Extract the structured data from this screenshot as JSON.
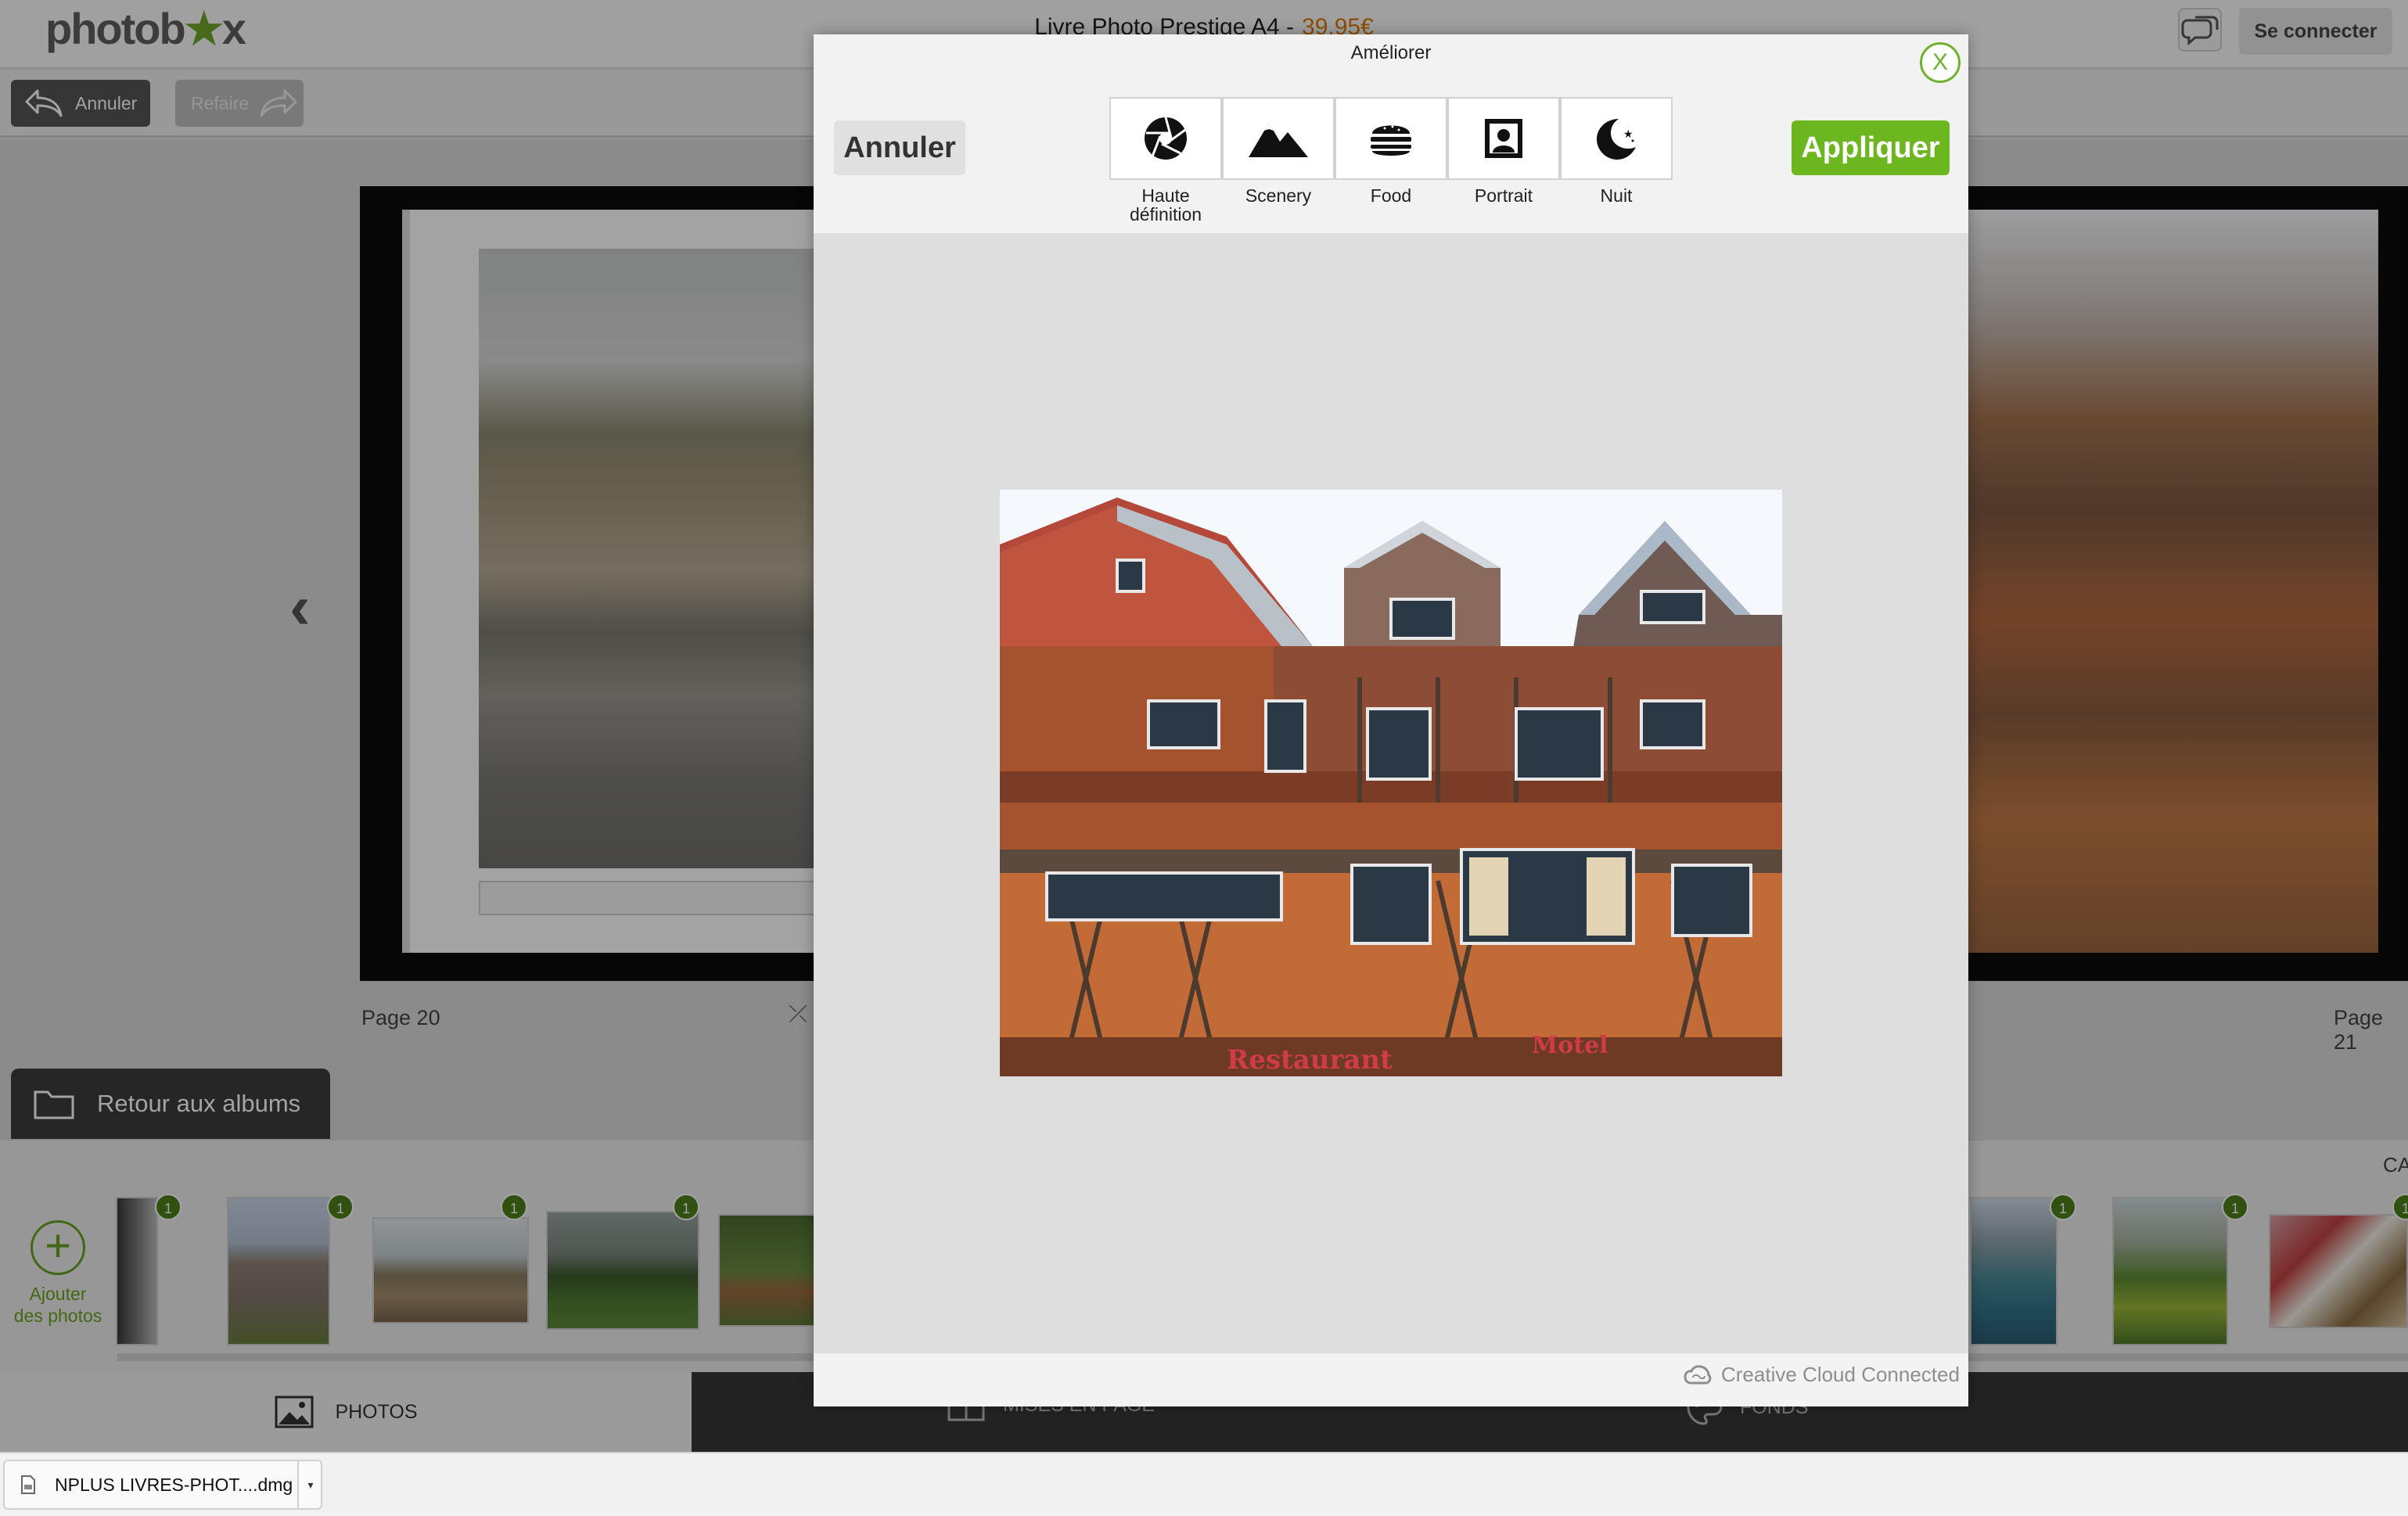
{
  "header": {
    "logo": {
      "pre": "photob",
      "post": "x"
    },
    "product_name": "Livre Photo Prestige A4 -",
    "product_price": "39.95€",
    "login_label": "Se connecter"
  },
  "toolbar": {
    "undo_label": "Annuler",
    "redo_label": "Refaire"
  },
  "book": {
    "left_page_label": "Page 20",
    "right_page_label": "Page 21"
  },
  "albums_button_label": "Retour aux albums",
  "photo_strip": {
    "add_label_line1": "Ajouter",
    "add_label_line2": "des photos",
    "badge_counts": [
      "1",
      "1",
      "1",
      "1",
      "1",
      "1",
      "1"
    ],
    "truncated_label": "CA"
  },
  "bottom_tabs": {
    "photos": "PHOTOS",
    "layouts": "MISES EN PAGE",
    "backgrounds": "FONDS"
  },
  "modal": {
    "title": "Améliorer",
    "close_label": "X",
    "cancel_label": "Annuler",
    "apply_label": "Appliquer",
    "presets": [
      {
        "label_line1": "Haute",
        "label_line2": "définition",
        "icon": "aperture-icon"
      },
      {
        "label_line1": "Scenery",
        "label_line2": "",
        "icon": "mountain-icon"
      },
      {
        "label_line1": "Food",
        "label_line2": "",
        "icon": "burger-icon"
      },
      {
        "label_line1": "Portrait",
        "label_line2": "",
        "icon": "portrait-icon"
      },
      {
        "label_line1": "Nuit",
        "label_line2": "",
        "icon": "moon-icon"
      }
    ],
    "preview_signs": {
      "restaurant": "Restaurant",
      "motel": "Motel"
    },
    "footer_label": "Creative Cloud Connected"
  },
  "download_bar": {
    "file_name": "NPLUS LIVRES-PHOT....dmg"
  },
  "colors": {
    "accent_green": "#6cb61f",
    "price_orange": "#e07b00",
    "badge_green": "#4b7f18"
  }
}
